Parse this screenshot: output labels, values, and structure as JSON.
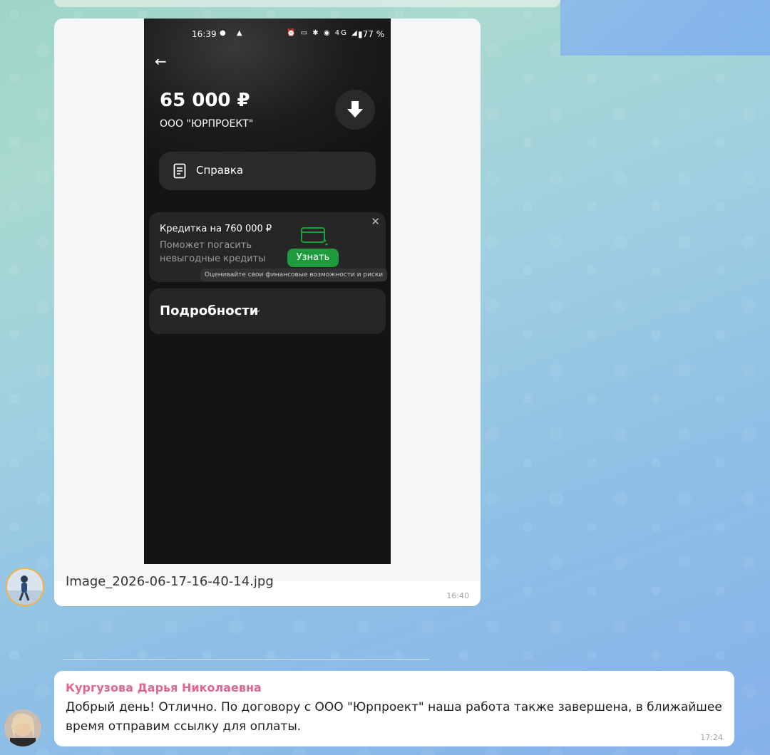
{
  "image_message": {
    "filename": "Image_2026-06-17-16-40-14.jpg",
    "time": "16:40",
    "screenshot": {
      "status": {
        "time": "16:39",
        "left_icons": "● ▲",
        "right_icons": "⏰ ▭ ✱ ◉ 4G ◢",
        "battery": "▮77 %"
      },
      "back_icon": "←",
      "amount": "65 000 ₽",
      "company": "ООО \"ЮРПРОЕКТ\"",
      "reference_label": "Справка",
      "promo": {
        "title": "Кредитка на 760 000 ₽",
        "subtitle": "Поможет погасить невыгодные кредиты",
        "button": "Узнать",
        "footnote": "Оценивайте свои финансовые возможности и риски",
        "close": "✕"
      },
      "details_label": "Подробности",
      "details_chevron": "⌄",
      "accent_color": "#1f9a3c"
    }
  },
  "text_message": {
    "sender": "Кургузова Дарья Николаевна",
    "text": "Добрый день! Отлично. По договору с ООО \"Юрпроект\" наша работа также завершена, в ближайшее время отправим ссылку для оплаты.",
    "time": "17:24",
    "sender_color": "#e2678d"
  }
}
